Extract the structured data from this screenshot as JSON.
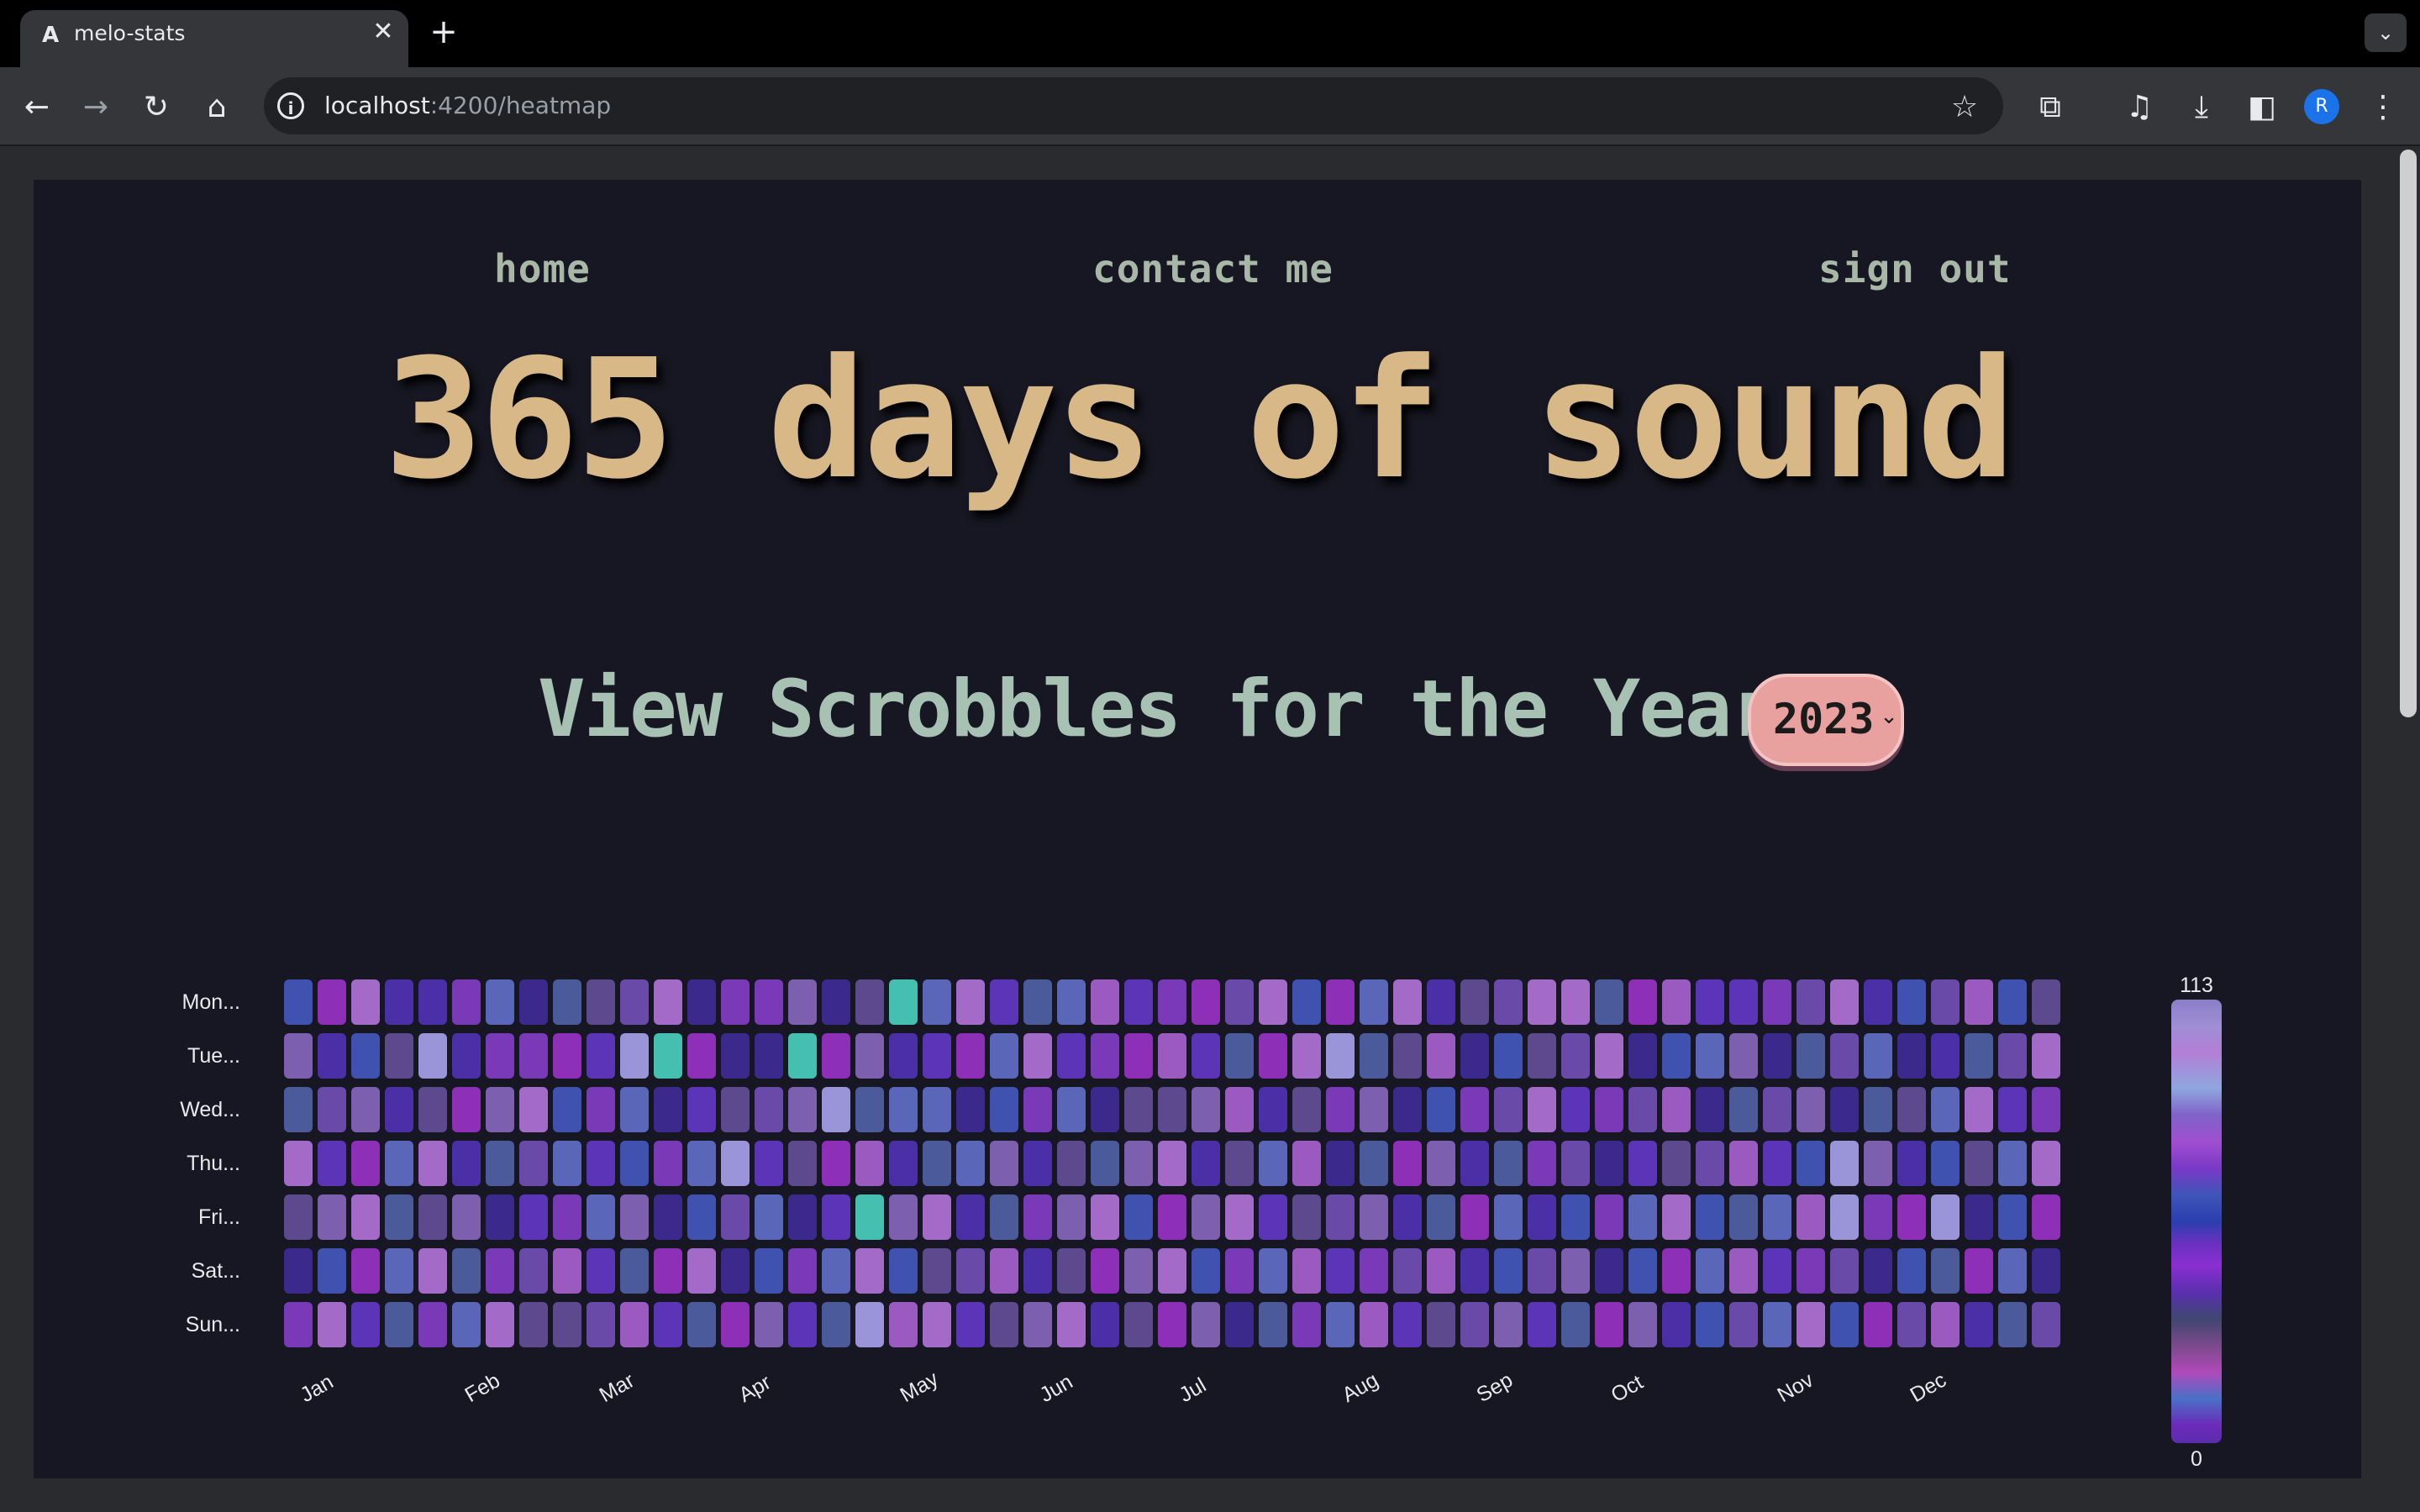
{
  "browser": {
    "tab_title": "melo-stats",
    "tab_favicon": "A",
    "close_glyph": "✕",
    "new_tab_glyph": "+",
    "tab_search_glyph": "⌄",
    "url_host": "localhost",
    "url_path": ":4200/heatmap",
    "avatar_letter": "R",
    "icons": {
      "back": "←",
      "forward": "→",
      "reload": "↻",
      "home": "⌂",
      "star": "☆",
      "extensions": "⧉",
      "media": "♫",
      "download": "⤓",
      "sidebar": "◧",
      "menu": "⋮",
      "info": "i"
    }
  },
  "nav": {
    "home": "home",
    "contact": "contact me",
    "signout": "sign out"
  },
  "page": {
    "title": "365 days of sound",
    "subtitle": "View Scrobbles for the Year",
    "year_selected": "2023",
    "year_chevron": "⌄"
  },
  "colors": {
    "title": "#d9b887",
    "nav": "#a9b8a6",
    "subtitle": "#a7c1b3",
    "select_bg": "#e9a19f",
    "panel_bg": "#171723"
  },
  "chart_data": {
    "type": "heatmap",
    "title": "",
    "y_categories": [
      "Mon...",
      "Tue...",
      "Wed...",
      "Thu...",
      "Fri...",
      "Sat...",
      "Sun..."
    ],
    "x_tick_labels": [
      "Jan",
      "Feb",
      "Mar",
      "Apr",
      "May",
      "Jun",
      "Jul",
      "Aug",
      "Sep",
      "Oct",
      "Nov",
      "Dec"
    ],
    "weeks": 53,
    "scale_min": 0,
    "scale_max": 113,
    "legend_max_label": "113",
    "legend_min_label": "0",
    "values": [
      [
        40,
        55,
        70,
        60,
        30,
        50,
        45,
        65,
        75,
        50,
        45,
        60,
        35,
        70,
        40,
        45,
        50,
        80,
        113,
        45,
        55,
        50,
        35,
        65,
        55,
        60,
        75,
        50,
        20,
        40,
        45,
        60,
        55,
        50,
        40,
        55,
        45,
        65,
        30,
        50,
        55,
        60,
        70,
        40,
        45,
        35,
        55,
        40,
        30,
        45,
        50,
        70,
        60
      ],
      [
        35,
        50,
        40,
        20,
        95,
        60,
        85,
        45,
        30,
        85,
        90,
        105,
        35,
        70,
        40,
        110,
        50,
        45,
        60,
        40,
        65,
        55,
        45,
        55,
        60,
        35,
        45,
        65,
        50,
        55,
        80,
        100,
        60,
        35,
        70,
        60,
        65,
        45,
        55,
        60,
        40,
        35,
        70,
        50,
        45,
        60,
        70,
        55,
        65,
        40,
        35,
        55,
        60
      ],
      [
        40,
        45,
        40,
        50,
        60,
        45,
        55,
        35,
        50,
        45,
        55,
        60,
        45,
        50,
        55,
        35,
        90,
        45,
        75,
        40,
        55,
        50,
        45,
        55,
        65,
        85,
        50,
        70,
        45,
        50,
        60,
        40,
        55,
        50,
        45,
        55,
        40,
        50,
        55,
        60,
        45,
        50,
        40,
        55,
        60,
        45,
        55,
        60,
        40,
        45,
        55,
        50,
        60
      ],
      [
        45,
        55,
        70,
        60,
        65,
        50,
        45,
        60,
        40,
        75,
        50,
        45,
        55,
        90,
        45,
        50,
        40,
        55,
        45,
        50,
        70,
        50,
        60,
        75,
        30,
        65,
        55,
        40,
        50,
        65,
        55,
        40,
        45,
        50,
        55,
        60,
        65,
        45,
        40,
        60,
        55,
        50,
        45,
        55,
        60,
        40,
        95,
        55,
        60,
        45,
        40,
        55,
        50
      ],
      [
        40,
        65,
        50,
        75,
        55,
        70,
        80,
        60,
        70,
        80,
        50,
        45,
        55,
        70,
        45,
        60,
        50,
        110,
        75,
        65,
        55,
        45,
        40,
        55,
        40,
        55,
        65,
        60,
        45,
        55,
        50,
        45,
        40,
        55,
        45,
        50,
        40,
        60,
        55,
        45,
        50,
        55,
        60,
        40,
        65,
        45,
        95,
        70,
        55,
        100,
        55,
        50,
        60
      ],
      [
        45,
        55,
        60,
        55,
        50,
        70,
        60,
        55,
        45,
        60,
        50,
        55,
        75,
        50,
        45,
        55,
        50,
        45,
        60,
        55,
        50,
        45,
        55,
        60,
        45,
        50,
        40,
        55,
        45,
        50,
        40,
        55,
        60,
        45,
        50,
        55,
        40,
        60,
        55,
        50,
        45,
        65,
        55,
        40,
        50,
        60,
        45,
        70,
        80,
        45,
        55,
        40,
        50
      ],
      [
        40,
        70,
        75,
        60,
        50,
        45,
        55,
        85,
        50,
        45,
        55,
        60,
        45,
        50,
        45,
        75,
        60,
        95,
        80,
        55,
        50,
        45,
        75,
        65,
        55,
        60,
        45,
        50,
        55,
        60,
        45,
        50,
        40,
        55,
        45,
        50,
        40,
        60,
        55,
        50,
        45,
        65,
        55,
        70,
        55,
        45,
        60,
        75,
        45,
        55,
        50,
        45,
        60
      ]
    ]
  }
}
